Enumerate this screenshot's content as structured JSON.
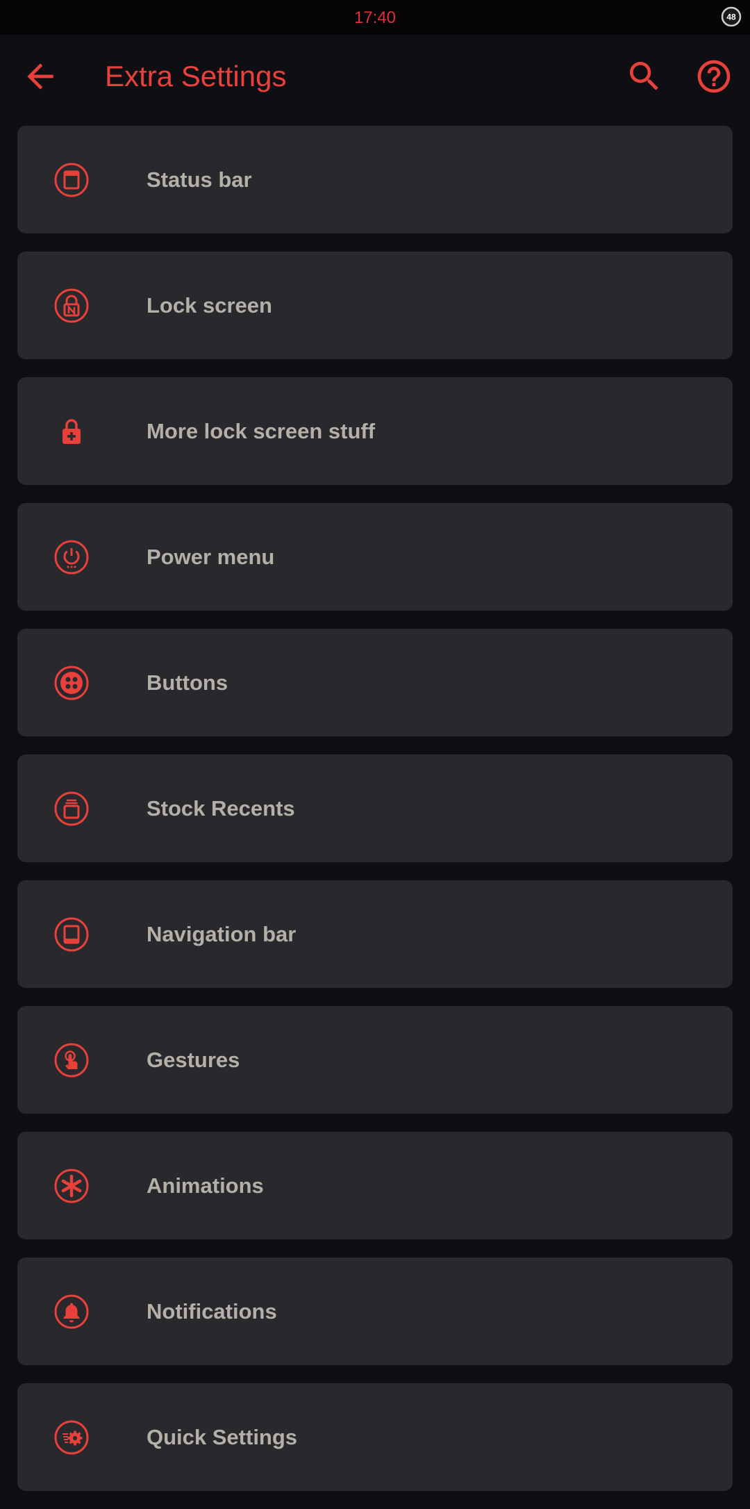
{
  "status_bar": {
    "time": "17:40",
    "battery_level": "48"
  },
  "app_bar": {
    "title": "Extra Settings",
    "back_icon": "arrow-back-icon",
    "search_icon": "search-icon",
    "help_icon": "help-icon"
  },
  "colors": {
    "accent": "#e8403a",
    "background": "#0f0f13",
    "card": "#28282d",
    "label": "#b4b0a8"
  },
  "items": [
    {
      "label": "Status bar",
      "icon": "status-bar-icon"
    },
    {
      "label": "Lock screen",
      "icon": "lock-screen-icon"
    },
    {
      "label": "More lock screen stuff",
      "icon": "lock-plus-icon"
    },
    {
      "label": "Power menu",
      "icon": "power-menu-icon"
    },
    {
      "label": "Buttons",
      "icon": "buttons-icon"
    },
    {
      "label": "Stock Recents",
      "icon": "recents-icon"
    },
    {
      "label": "Navigation bar",
      "icon": "navigation-bar-icon"
    },
    {
      "label": "Gestures",
      "icon": "gesture-icon"
    },
    {
      "label": "Animations",
      "icon": "animation-icon"
    },
    {
      "label": "Notifications",
      "icon": "notification-bell-icon"
    },
    {
      "label": "Quick Settings",
      "icon": "quick-settings-icon"
    }
  ]
}
